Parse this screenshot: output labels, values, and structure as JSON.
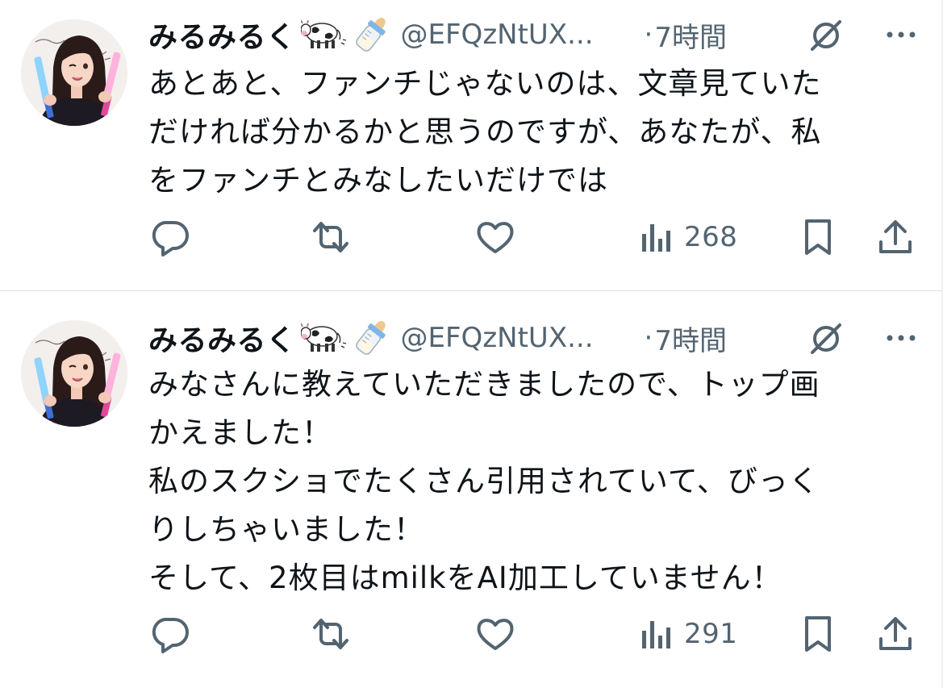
{
  "tweets": [
    {
      "display_name": "みるみるく",
      "name_emojis": [
        "cow-emoji",
        "baby-bottle-emoji"
      ],
      "handle": "@EFQzNtUX...",
      "separator": "·",
      "time": "7時間",
      "text_lines": [
        "あとあと、ファンチじゃないのは、文章見ていた",
        "だければ分かるかと思うのですが、あなたが、私",
        "をファンチとみなしたいだけでは"
      ],
      "views": "268",
      "icons": [
        "reply-icon",
        "repost-icon",
        "like-icon",
        "views-icon",
        "bookmark-icon",
        "share-icon"
      ]
    },
    {
      "display_name": "みるみるく",
      "name_emojis": [
        "cow-emoji",
        "baby-bottle-emoji"
      ],
      "handle": "@EFQzNtUX...",
      "separator": "·",
      "time": "7時間",
      "text_lines": [
        "みなさんに教えていただきましたので、トップ画",
        "かえました！",
        "私のスクショでたくさん引用されていて、びっく",
        "りしちゃいました！",
        "そして、2枚目はmilkをAI加工していません！"
      ],
      "views": "291",
      "icons": [
        "reply-icon",
        "repost-icon",
        "like-icon",
        "views-icon",
        "bookmark-icon",
        "share-icon"
      ]
    }
  ],
  "colors": {
    "text": "#0f1419",
    "secondary": "#536471",
    "divider": "#d9dde1"
  }
}
